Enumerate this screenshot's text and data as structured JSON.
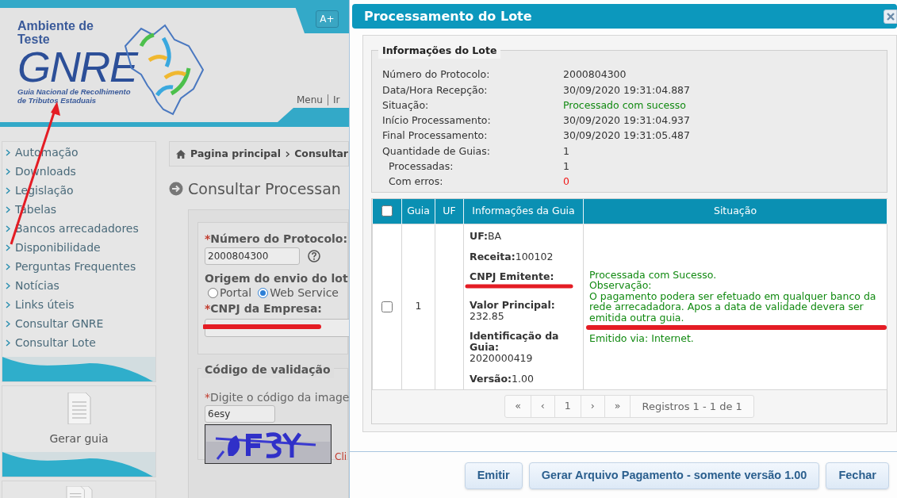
{
  "background_page": {
    "header": {
      "logo_line_1": "Ambiente de",
      "logo_line_2": "Teste",
      "logo_main": "GNRE",
      "logo_caption_1": "Guia Nacional de Recolhimento",
      "logo_caption_2": "de Tributos Estaduais",
      "font_button": "A+",
      "nav_links": [
        "Menu",
        "Ir"
      ]
    },
    "sidebar": {
      "items": [
        "Automação",
        "Downloads",
        "Legislação",
        "Tabelas",
        "Bancos arrecadadores",
        "Disponibilidade",
        "Perguntas Frequentes",
        "Notícias",
        "Links úteis",
        "Consultar GNRE",
        "Consultar Lote"
      ],
      "cards": [
        {
          "label": "Gerar guia"
        }
      ]
    },
    "breadcrumb": [
      "Pagina principal",
      "Consultar"
    ],
    "heading": "Consultar Processan",
    "form": {
      "protocol": {
        "mark": "*",
        "label": "Número do Protocolo:",
        "value": "2000804300"
      },
      "origin": {
        "label": "Origem do envio do lot",
        "options": [
          {
            "label": "Portal",
            "selected": false
          },
          {
            "label": "Web Service",
            "selected": true
          }
        ]
      },
      "cnpj": {
        "mark": "*",
        "label": "CNPJ da Empresa:",
        "redacted": true
      },
      "validation": {
        "legend": "Código de validação",
        "mark": "*",
        "label": "Digite o código da image",
        "value": "6esy",
        "link": "Cli"
      }
    }
  },
  "dialog": {
    "title": "Processamento do Lote",
    "lot_info": {
      "legend": "Informações do Lote",
      "rows": [
        {
          "label": "Número do Protocolo:",
          "value": "2000804300",
          "color": "#333333"
        },
        {
          "label": "Data/Hora Recepção:",
          "value": "30/09/2020 19:31:04.887",
          "color": "#333333"
        },
        {
          "label": "Situação:",
          "value": "Processado com sucesso",
          "color": "#128a12"
        },
        {
          "label": "Início Processamento:",
          "value": "30/09/2020 19:31:04.937",
          "color": "#333333"
        },
        {
          "label": "Final Processamento:",
          "value": "30/09/2020 19:31:05.487",
          "color": "#333333"
        },
        {
          "label": "Quantidade de Guias:",
          "value": "1",
          "color": "#333333",
          "children": [
            {
              "label": "Processadas:",
              "value": "1",
              "color": "#333333"
            },
            {
              "label": "Com erros:",
              "value": "0",
              "color": "#f01818"
            }
          ]
        }
      ]
    },
    "table": {
      "select_all_checked": false,
      "columns": [
        "Guia",
        "UF",
        "Informações da Guia",
        "Situação"
      ],
      "rows": [
        {
          "checked": false,
          "guia": "1",
          "info": [
            {
              "kind": "inline",
              "text": "**UF:**BA"
            },
            {
              "kind": "inline",
              "text": "**Receita:**100102"
            },
            {
              "kind": "block",
              "label": "CNPJ Emitente:",
              "redacted": true
            },
            {
              "kind": "block",
              "label": "Valor Principal:",
              "value": "232.85"
            },
            {
              "kind": "block",
              "label": "Identificação da Guia:",
              "value": "2020000419"
            },
            {
              "kind": "inline",
              "text": "**Versão:**1.00"
            }
          ],
          "situation": [
            {
              "kind": "text",
              "text": "Processada com Sucesso."
            },
            {
              "kind": "text",
              "text": "Observação:"
            },
            {
              "kind": "text",
              "text": "O pagamento podera ser efetuado em qualquer banco da rede arrecadadora. Apos a data de validade devera ser emitida outra guia."
            },
            {
              "kind": "redacted"
            },
            {
              "kind": "text",
              "text": "Emitido via: Internet."
            }
          ]
        }
      ],
      "pagination": {
        "buttons": [
          "«",
          "‹",
          "1",
          "›",
          "»"
        ],
        "summary": "Registros 1 - 1 de 1"
      }
    },
    "buttons": [
      "Emitir",
      "Gerar Arquivo Pagamento - somente versão 1.00",
      "Fechar"
    ]
  }
}
